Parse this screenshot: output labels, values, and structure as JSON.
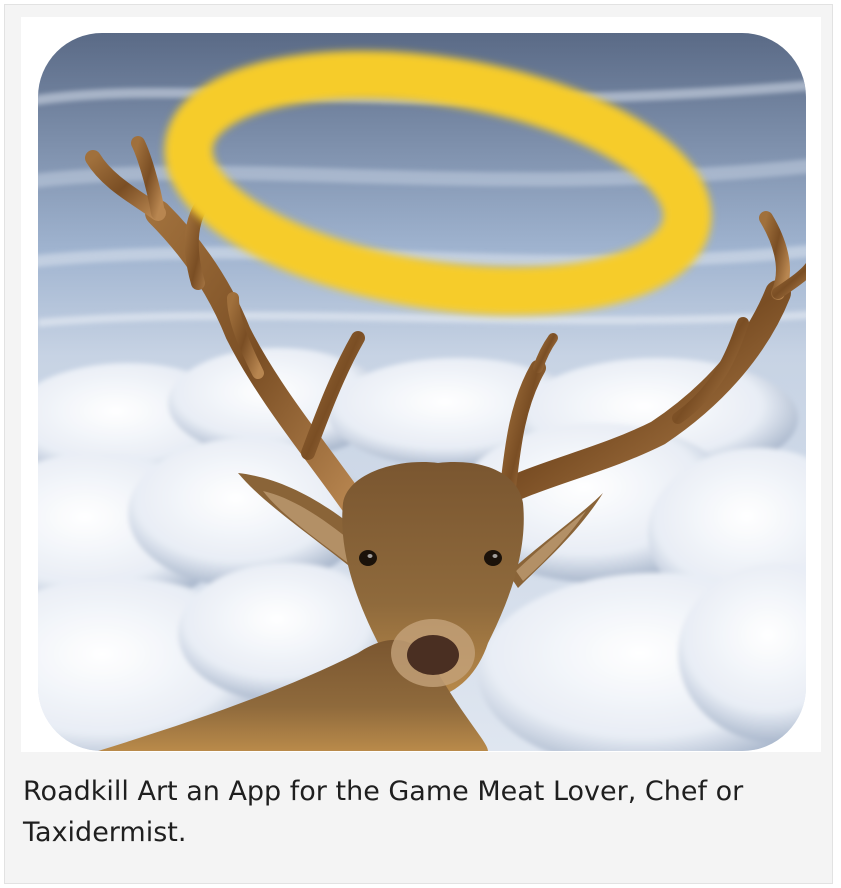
{
  "image": {
    "subject": "deer-with-halo",
    "colors": {
      "sky_top": "#5a6a86",
      "sky_mid": "#9fb3cf",
      "cloud": "#eef2f8",
      "cloud_shadow": "#8a9ab4",
      "halo": "#f6cc2a",
      "antler": "#8b5a2b",
      "antler_light": "#c9975a",
      "fur": "#8a6438",
      "fur_light": "#c4a37a",
      "eye": "#1b120a",
      "nose": "#4a2f22"
    }
  },
  "caption": {
    "text": "Roadkill Art an App for the Game Meat Lover, Chef or Taxidermist."
  }
}
